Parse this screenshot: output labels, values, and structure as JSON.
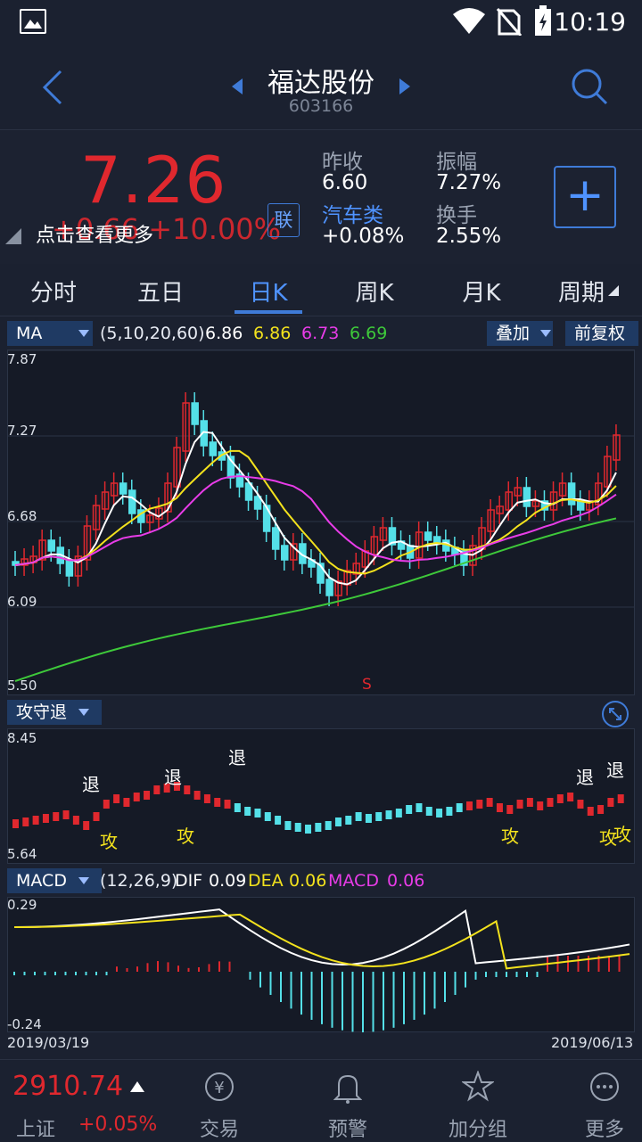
{
  "status_bar": {
    "time": "10:19"
  },
  "header": {
    "title": "福达股份",
    "code": "603166"
  },
  "quote": {
    "price": "7.26",
    "change": "+0.66  +10.00%",
    "tip": "点击查看更多",
    "lian_label": "联",
    "fields": [
      {
        "label": "昨收",
        "value": "6.60"
      },
      {
        "label": "振幅",
        "value": "7.27%"
      },
      {
        "label": "汽车类",
        "value": "+0.08%"
      },
      {
        "label": "换手",
        "value": "2.55%"
      }
    ]
  },
  "tabs": [
    "分时",
    "五日",
    "日K",
    "周K",
    "月K",
    "周期"
  ],
  "active_tab": "日K",
  "ma_bar": {
    "dropdown": "MA",
    "params": "(5,10,20,60)",
    "values": [
      "6.86",
      "6.86",
      "6.73",
      "6.69"
    ],
    "colors": [
      "#ffffff",
      "#f3e21d",
      "#e83ce8",
      "#3ec93a"
    ],
    "overlay": "叠加",
    "adjust": "前复权"
  },
  "kline_axis": [
    "7.87",
    "7.27",
    "6.68",
    "6.09",
    "5.50"
  ],
  "kline_marker": "S",
  "gsf_bar": {
    "dropdown": "攻守退"
  },
  "gsf_axis": [
    "8.45",
    "5.64"
  ],
  "gsf_signals": {
    "retreat": "退",
    "attack": "攻"
  },
  "macd_bar": {
    "dropdown": "MACD",
    "params": "(12,26,9)",
    "items": [
      {
        "label": "DIF",
        "value": "0.09"
      },
      {
        "label": "DEA",
        "value": "0.06"
      },
      {
        "label": "MACD",
        "value": "0.06"
      }
    ]
  },
  "macd_axis": [
    "0.29",
    "-0.24"
  ],
  "dates": {
    "start": "2019/03/19",
    "end": "2019/06/13"
  },
  "bottom": {
    "index_value": "2910.74",
    "index_name": "上证",
    "index_change": "+0.05%",
    "nav": [
      "交易",
      "预警",
      "加分组",
      "更多"
    ]
  }
}
